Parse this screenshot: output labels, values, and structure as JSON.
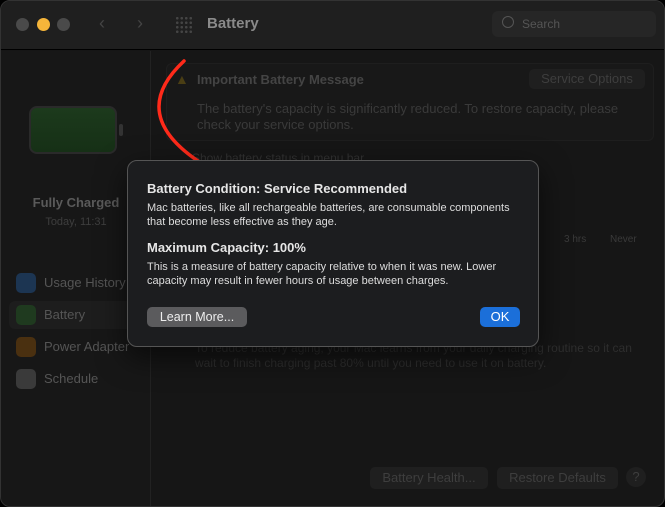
{
  "window": {
    "title": "Battery",
    "search_placeholder": "Search"
  },
  "sidebar": {
    "status": "Fully Charged",
    "time": "Today, 11:31",
    "items": [
      {
        "label": "Usage History"
      },
      {
        "label": "Battery"
      },
      {
        "label": "Power Adapter"
      },
      {
        "label": "Schedule"
      }
    ]
  },
  "main": {
    "message_title": "Important Battery Message",
    "service_options": "Service Options",
    "message_body": "The battery's capacity is significantly reduced. To restore capacity, please check your service options.",
    "checkbox_label": "Show battery status in menu bar",
    "tick_3hrs": "3 hrs",
    "tick_never": "Never",
    "optimized_desc": "To reduce battery aging, your Mac learns from your daily charging routine so it can wait to finish charging past 80% until you need to use it on battery.",
    "battery_health": "Battery Health...",
    "restore_defaults": "Restore Defaults",
    "help": "?"
  },
  "dialog": {
    "title": "Battery Condition: Service Recommended",
    "body1": "Mac batteries, like all rechargeable batteries, are consumable components that become less effective as they age.",
    "capacity_title": "Maximum Capacity: 100%",
    "body2": "This is a measure of battery capacity relative to when it was new. Lower capacity may result in fewer hours of usage between charges.",
    "learn_more": "Learn More...",
    "ok": "OK"
  },
  "colors": {
    "accent": "#1b6fd9",
    "annotation": "#ff2a1a",
    "close": "#4a4a4a",
    "minimize": "#f5b53a"
  }
}
